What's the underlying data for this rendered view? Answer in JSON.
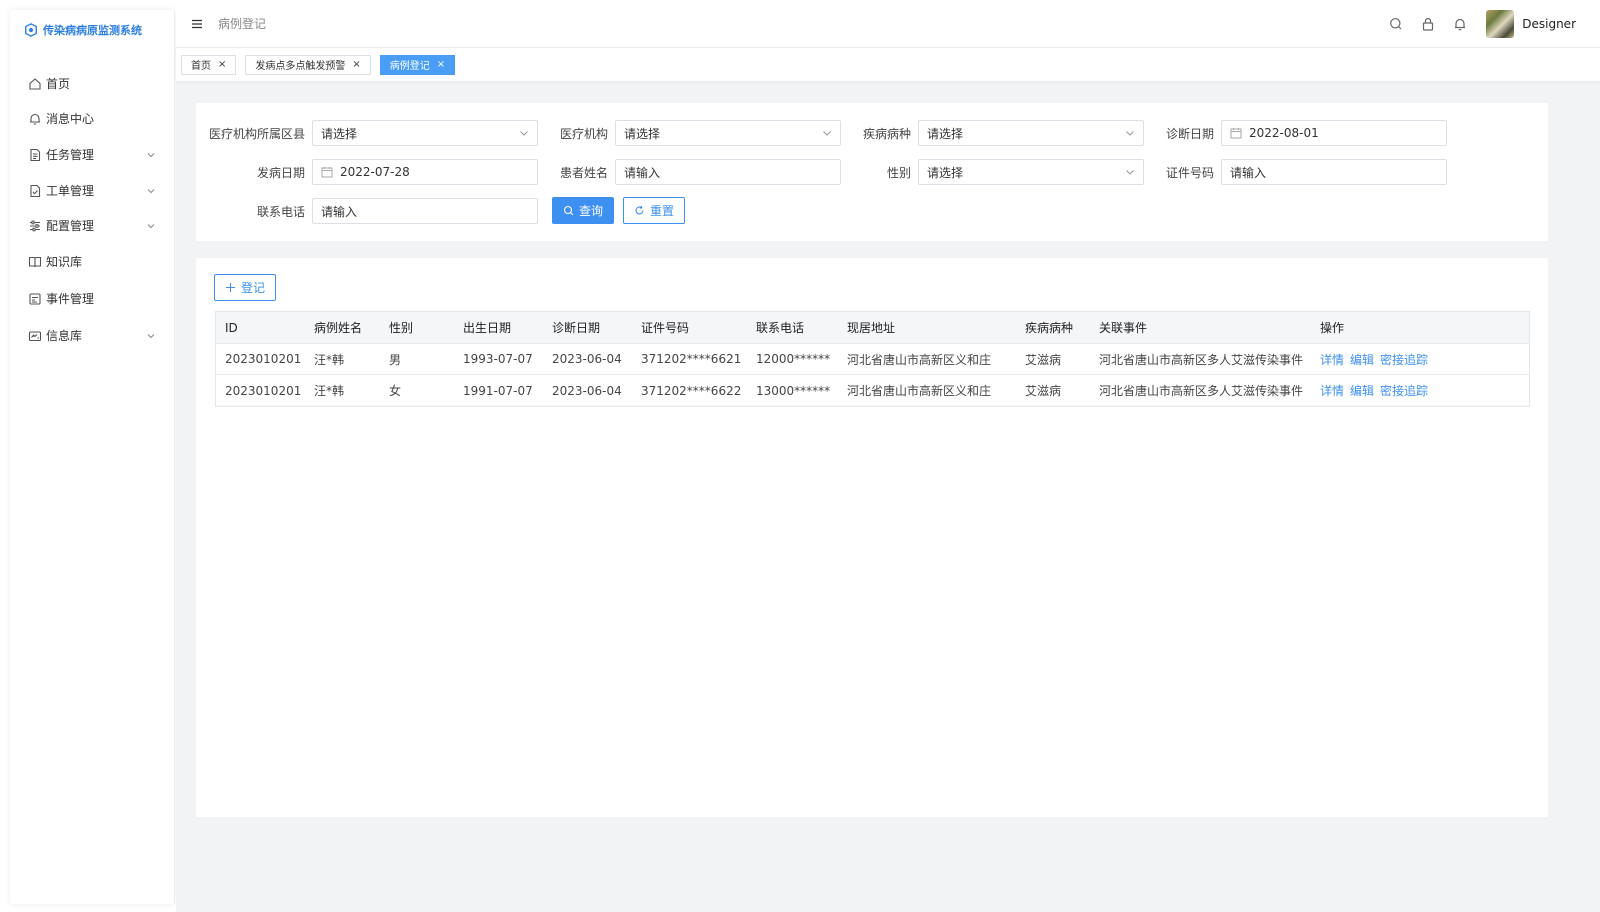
{
  "app": {
    "title": "传染病病原监测系统"
  },
  "sidebar": {
    "items": [
      {
        "label": "首页",
        "icon": "home-icon",
        "expandable": false
      },
      {
        "label": "消息中心",
        "icon": "bell-icon",
        "expandable": false
      },
      {
        "label": "任务管理",
        "icon": "document-icon",
        "expandable": true
      },
      {
        "label": "工单管理",
        "icon": "file-check-icon",
        "expandable": true
      },
      {
        "label": "配置管理",
        "icon": "sliders-icon",
        "expandable": true
      },
      {
        "label": "知识库",
        "icon": "book-icon",
        "expandable": false
      },
      {
        "label": "事件管理",
        "icon": "calendar-icon",
        "expandable": false
      },
      {
        "label": "信息库",
        "icon": "card-icon",
        "expandable": true
      }
    ]
  },
  "header": {
    "breadcrumb": "病例登记",
    "username": "Designer"
  },
  "tabs": [
    {
      "label": "首页",
      "active": false
    },
    {
      "label": "发病点多点触发预警",
      "active": false
    },
    {
      "label": "病例登记",
      "active": true
    }
  ],
  "filters": {
    "region": {
      "label": "医疗机构所属区县",
      "value": "请选择"
    },
    "institution": {
      "label": "医疗机构",
      "value": "请选择"
    },
    "disease": {
      "label": "疾病病种",
      "value": "请选择"
    },
    "diagnosis_date": {
      "label": "诊断日期",
      "value": "2022-08-01"
    },
    "onset_date": {
      "label": "发病日期",
      "value": "2022-07-28"
    },
    "patient_name": {
      "label": "患者姓名",
      "value": "请输入"
    },
    "gender": {
      "label": "性别",
      "value": "请选择"
    },
    "id_number": {
      "label": "证件号码",
      "value": "请输入"
    },
    "phone": {
      "label": "联系电话",
      "value": "请输入"
    },
    "query_label": "查询",
    "reset_label": "重置"
  },
  "table": {
    "add_label": "登记",
    "columns": [
      "ID",
      "病例姓名",
      "性别",
      "出生日期",
      "诊断日期",
      "证件号码",
      "联系电话",
      "现居地址",
      "疾病病种",
      "关联事件",
      "操作"
    ],
    "rows": [
      {
        "id": "2023010201",
        "name": "汪*韩",
        "gender": "男",
        "birth": "1993-07-07",
        "diag": "2023-06-04",
        "idno": "371202****6621",
        "phone": "12000******",
        "address": "河北省唐山市高新区义和庄",
        "disease": "艾滋病",
        "event": "河北省唐山市高新区多人艾滋传染事件",
        "ops": [
          "详情",
          "编辑",
          "密接追踪"
        ]
      },
      {
        "id": "2023010201",
        "name": "汪*韩",
        "gender": "女",
        "birth": "1991-07-07",
        "diag": "2023-06-04",
        "idno": "371202****6622",
        "phone": "13000******",
        "address": "河北省唐山市高新区义和庄",
        "disease": "艾滋病",
        "event": "河北省唐山市高新区多人艾滋传染事件",
        "ops": [
          "详情",
          "编辑",
          "密接追踪"
        ]
      }
    ]
  },
  "colors": {
    "accent": "#3d8ff0",
    "background": "#f2f3f5"
  }
}
